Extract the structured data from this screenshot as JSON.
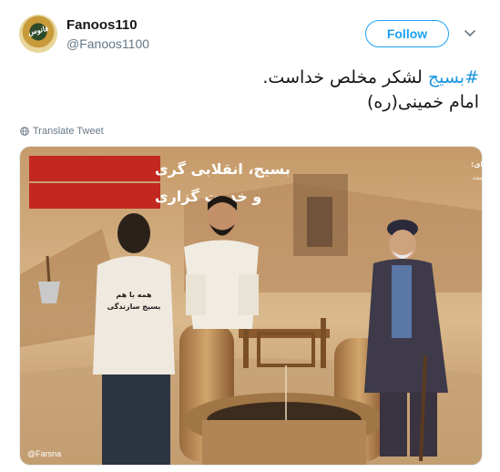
{
  "user": {
    "name": "Fanoos110",
    "handle": "@Fanoos1100",
    "avatar_text": "فانوس"
  },
  "follow_label": "Follow",
  "tweet": {
    "hashtag": "#بسیج",
    "line1_rest": " لشکر مخلص خداست.",
    "line2": "امام خمینی(ره)"
  },
  "translate_label": "Translate Tweet",
  "image": {
    "title_line1": "بسیج، انقلابی گری",
    "title_line2": "و خدمت گزاری",
    "quote_author": "امام خامنه‌ای:",
    "quote_text": "هر جا وظیفه‌ای باشد، انسان بسیجی در میدان آن وظیفه حاضر است.",
    "shirt_line1": "همه با هم",
    "shirt_line2": "بسیج سازندگی",
    "watermark": "@Farsna"
  },
  "colors": {
    "link": "#1b95e0",
    "follow": "#1da1f2",
    "muted": "#657786",
    "banner": "#c2281f"
  }
}
